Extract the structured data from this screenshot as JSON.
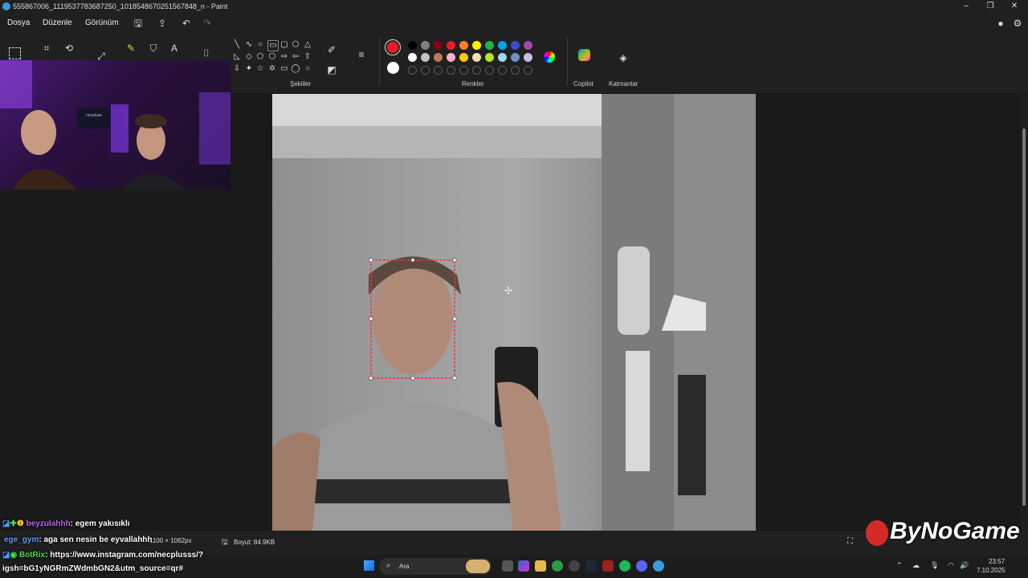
{
  "window": {
    "title": "555867006_1119537783687250_1018548670251567848_n - Paint",
    "minimize": "–",
    "maximize": "❐",
    "close": "✕"
  },
  "menu": {
    "items": [
      "Dosya",
      "Düzenle",
      "Görünüm"
    ]
  },
  "ribbon": {
    "groups": {
      "shapes": "Şekiller",
      "colors": "Renkler",
      "copilot": "Copilot",
      "layers": "Katmanlar"
    },
    "palette_row1": [
      "#000000",
      "#7f7f7f",
      "#880015",
      "#ed1c24",
      "#ff7f27",
      "#fff200",
      "#22b14c",
      "#00a2e8",
      "#3f48cc",
      "#a349a4"
    ],
    "palette_row2": [
      "#ffffff",
      "#c3c3c3",
      "#b97a57",
      "#ffaec9",
      "#ffc90e",
      "#efe4b0",
      "#b5e61d",
      "#99d9ea",
      "#7092be",
      "#c8bfe7"
    ],
    "primary_color": "#ed1c24",
    "secondary_color": "#ffffff"
  },
  "statusbar": {
    "dimensions": "1100 × 1062px",
    "size": "Boyut: 84.9KB"
  },
  "taskbar": {
    "search_placeholder": "Ara",
    "time": "23:57",
    "date": "7.10.2025"
  },
  "chat": [
    {
      "user": "beyzulahhh",
      "message": ": egem yakısıklı",
      "color": "#b569e8"
    },
    {
      "user": "ege_gym",
      "message": ": aga sen nesin be eyvallahhh",
      "color": "#5aa0ff"
    },
    {
      "user": "BotRix",
      "message": ": https://www.instagram.com/necplusss/?",
      "color": "#4bdc4b"
    },
    {
      "user": "",
      "message": "igsh=bG1yNGRmZWdmbGN2&utm_source=qr#",
      "color": "#ffffff"
    }
  ],
  "overlay": {
    "webcam_screen_text": "necpluss",
    "watermark": "ByNoGame"
  }
}
